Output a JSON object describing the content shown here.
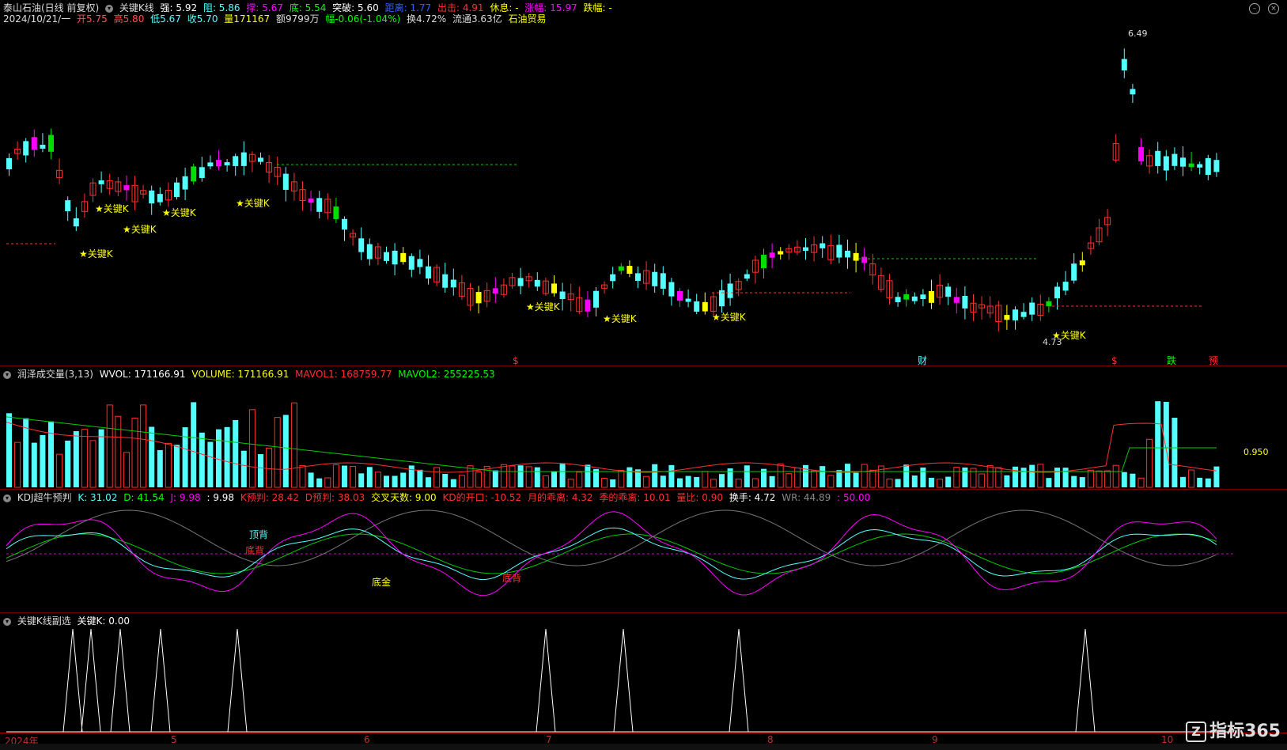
{
  "header": {
    "stock_name": "泰山石油(日线 前复权)",
    "indicator": "关键K线",
    "strong": "强: 5.92",
    "resist": "阻: 5.86",
    "pressure": "撑: 5.67",
    "bottom": "底: 5.54",
    "breakout": "突破: 5.60",
    "distance": "距离: 1.77",
    "exit": "出击: 4.91",
    "rest": "休息: -",
    "rise": "涨幅: 15.97",
    "fall": "跌幅: -"
  },
  "quote": {
    "date": "2024/10/21/一",
    "open": "开5.75",
    "high": "高5.80",
    "low": "低5.67",
    "close": "收5.70",
    "volume": "量171167",
    "amount": "额9799万",
    "change": "幅-0.06(-1.04%)",
    "turnover": "换4.72%",
    "float": "流通3.63亿",
    "sector": "石油贸易"
  },
  "main_annotations": {
    "key_k": "★关键K",
    "high_label": "6.49",
    "low_label": "4.73",
    "markers": [
      "$",
      "财",
      "$",
      "跌",
      "预"
    ]
  },
  "volume_panel": {
    "title": "润泽成交量(3,13)",
    "wvol": "WVOL: 171166.91",
    "volume": "VOLUME: 171166.91",
    "mavol1": "MAVOL1: 168759.77",
    "mavol2": "MAVOL2: 255225.53",
    "right_label": "0.950"
  },
  "kdj_panel": {
    "title": "KDJ超牛预判",
    "k": "K: 31.02",
    "d": "D: 41.54",
    "j": "J: 9.98",
    "blank": ": 9.98",
    "k_pred": "K预判: 28.42",
    "d_pred": "D预判: 38.03",
    "cross_days": "交叉天数: 9.00",
    "kd_gap": "KD的开口: -10.52",
    "month_dev": "月的乖离: 4.32",
    "season_dev": "季的乖离: 10.01",
    "volume_ratio": "量比: 0.90",
    "turnover": "换手: 4.72",
    "wr": "WR: 44.89",
    "extra": ": 50.00",
    "labels": [
      "顶背",
      "底背",
      "底金",
      "底背"
    ]
  },
  "keyk_panel": {
    "title": "关键K线副选",
    "value": "关键K: 0.00"
  },
  "x_axis": {
    "labels": [
      "2024年",
      "5",
      "6",
      "7",
      "8",
      "9",
      "10"
    ]
  },
  "logo": {
    "text": "指标365",
    "mark": "Z"
  },
  "colors": {
    "up": "#ff3030",
    "down": "#54ffff",
    "key_up": "#ff00ff",
    "key_down": "#00dd00",
    "yellow": "#ffff00"
  }
}
